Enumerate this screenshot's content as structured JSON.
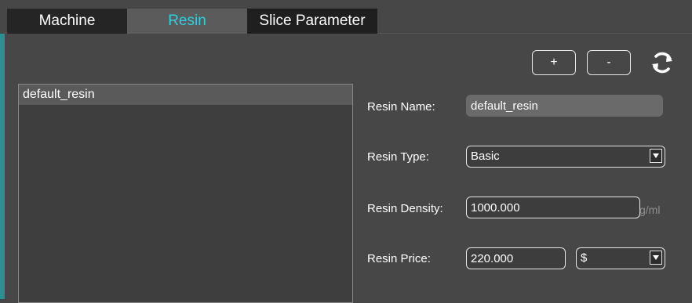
{
  "tabs": [
    {
      "label": "Machine",
      "active": false
    },
    {
      "label": "Resin",
      "active": true
    },
    {
      "label": "Slice Parameter",
      "active": false
    }
  ],
  "toolbar": {
    "add_label": "+",
    "remove_label": "-",
    "refresh_icon": "refresh-icon"
  },
  "resin_list": {
    "items": [
      "default_resin"
    ],
    "selected": "default_resin"
  },
  "form": {
    "name": {
      "label": "Resin Name:",
      "value": "default_resin"
    },
    "type": {
      "label": "Resin Type:",
      "value": "Basic"
    },
    "density": {
      "label": "Resin Density:",
      "value": "1000.000",
      "unit": "g/ml"
    },
    "price": {
      "label": "Resin Price:",
      "value": "220.000",
      "currency": "$"
    }
  },
  "colors": {
    "background": "#474747",
    "active_tab_text": "#2fd1de",
    "field_border": "#e6e6e6",
    "teal_edge": "#2d8f91"
  }
}
